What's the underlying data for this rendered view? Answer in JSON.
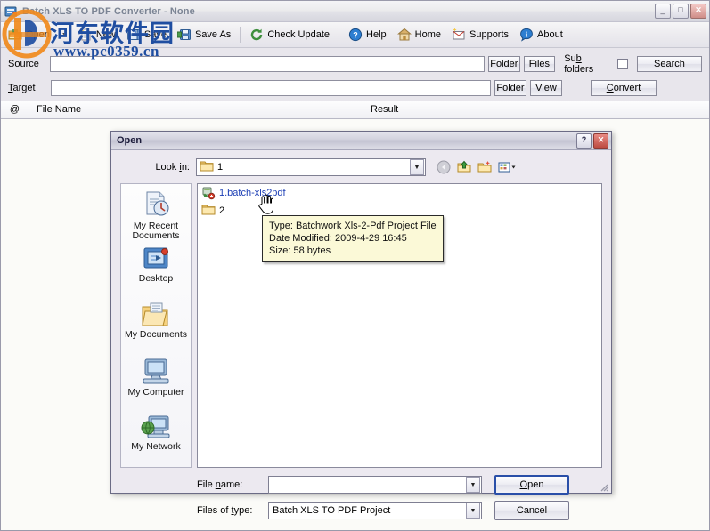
{
  "app": {
    "title": "Batch XLS TO PDF Converter - None",
    "window_buttons": {
      "minimize": "_",
      "maximize": "□",
      "close": "✕"
    },
    "toolbar": [
      {
        "label": "Open",
        "icon": "open-folder-icon",
        "has_dropdown": true
      },
      {
        "label": "New",
        "icon": "new-document-icon",
        "has_dropdown": false
      },
      {
        "label": "Save",
        "icon": "save-disk-icon",
        "has_dropdown": false
      },
      {
        "label": "Save As",
        "icon": "save-as-disk-icon",
        "has_dropdown": false
      },
      {
        "label": "Check Update",
        "icon": "refresh-icon",
        "has_dropdown": false
      },
      {
        "label": "Help",
        "icon": "help-question-icon",
        "has_dropdown": false
      },
      {
        "label": "Home",
        "icon": "home-icon",
        "has_dropdown": false
      },
      {
        "label": "Supports",
        "icon": "mail-icon",
        "has_dropdown": false
      },
      {
        "label": "About",
        "icon": "info-icon",
        "has_dropdown": false
      }
    ],
    "form": {
      "source_label": "Source",
      "source_value": "",
      "target_label": "Target",
      "target_value": "",
      "folder_label": "Folder",
      "files_label": "Files",
      "view_label": "View",
      "subfolders_label": "Sub folders",
      "subfolders_checked": false,
      "search_label": "Search",
      "convert_label": "Convert"
    },
    "list_headers": {
      "at": "@",
      "file_name": "File Name",
      "result": "Result"
    },
    "list_rows": []
  },
  "watermark": {
    "chinese": "河东软件园",
    "url": "www.pc0359.cn",
    "color": "#1f4ea1",
    "logo_orange": "#f08a1c",
    "logo_blue": "#1f4ea1"
  },
  "dialog": {
    "title": "Open",
    "help_button": "?",
    "close_button": "✕",
    "lookin_label": "Look in:",
    "lookin_value": "1",
    "nav_icons": [
      {
        "name": "back-icon",
        "title": "Back"
      },
      {
        "name": "up-one-level-icon",
        "title": "Up One Level"
      },
      {
        "name": "new-folder-icon",
        "title": "Create New Folder"
      },
      {
        "name": "views-icon",
        "title": "Views"
      }
    ],
    "places": [
      {
        "label": "My Recent Documents",
        "icon": "recent-documents-icon"
      },
      {
        "label": "Desktop",
        "icon": "desktop-icon"
      },
      {
        "label": "My Documents",
        "icon": "my-documents-icon"
      },
      {
        "label": "My Computer",
        "icon": "my-computer-icon"
      },
      {
        "label": "My Network",
        "icon": "my-network-icon"
      }
    ],
    "files": [
      {
        "name": "1.batch-xls2pdf",
        "icon": "batch-project-file-icon",
        "type": "file",
        "hovered": true
      },
      {
        "name": "2",
        "icon": "folder-icon",
        "type": "folder",
        "hovered": false
      }
    ],
    "tooltip": {
      "type_line": "Type: Batchwork Xls-2-Pdf Project File",
      "date_line": "Date Modified: 2009-4-29 16:45",
      "size_line": "Size: 58 bytes"
    },
    "filename_label": "File name:",
    "filename_value": "",
    "filetype_label": "Files of type:",
    "filetype_value": "Batch XLS TO PDF Project",
    "open_button": "Open",
    "cancel_button": "Cancel"
  }
}
